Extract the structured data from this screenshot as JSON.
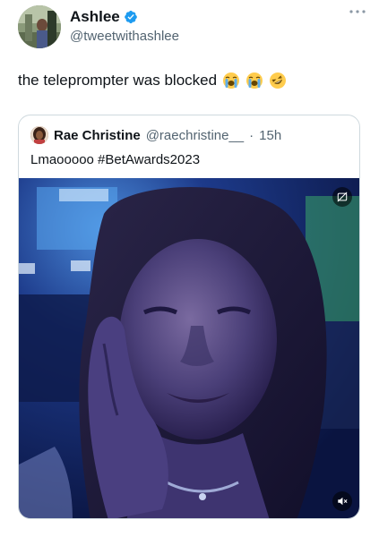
{
  "tweet": {
    "author": {
      "display_name": "Ashlee",
      "handle": "@tweetwithashlee",
      "verified": true
    },
    "more_icon": "more-horizontal-icon",
    "text": "the teleprompter was blocked",
    "emojis": [
      "loudly-crying-face",
      "loudly-crying-face",
      "rolling-on-the-floor-laughing"
    ]
  },
  "quoted_tweet": {
    "author": {
      "display_name": "Rae Christine",
      "handle": "@raechristine__",
      "separator": "·",
      "time_ago": "15h"
    },
    "text": "Lmaooooo #BetAwards2023",
    "media": {
      "type": "video",
      "top_icon": "gif-crossed-icon",
      "bottom_icon": "speaker-muted-icon"
    }
  },
  "colors": {
    "verified_blue": "#1d9bf0",
    "text_primary": "#0f1419",
    "text_secondary": "#536471",
    "border": "#cfd9de"
  }
}
